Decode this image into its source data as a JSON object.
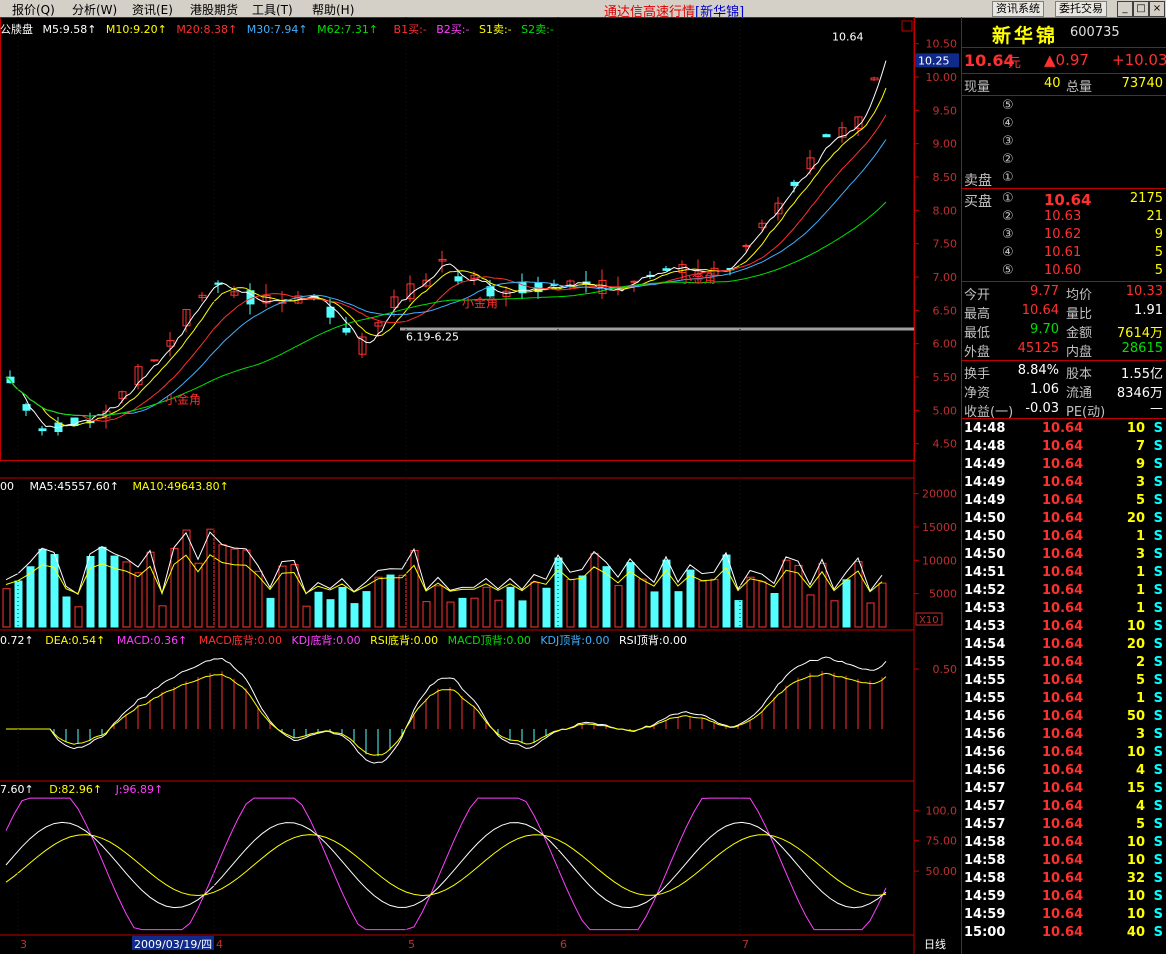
{
  "menu": {
    "items": [
      "报价(Q)",
      "分析(W)",
      "资讯(E)",
      "港股期货",
      "工具(T)",
      "帮助(H)"
    ],
    "title": "通达信高速行情",
    "title_stock": "[新华锦]",
    "btn_info": "资讯系统",
    "btn_trade": "委托交易",
    "win_min": "_",
    "win_max": "□",
    "win_close": "×"
  },
  "main_legend": {
    "title": "公牍盘",
    "ma5": "M5:9.58↑",
    "ma10": "M10:9.20↑",
    "ma20": "M20:8.38↑",
    "ma30": "M30:7.94↑",
    "ma62": "M62:7.31↑",
    "b1": "B1买:-",
    "b2": "B2买:-",
    "s1": "S1卖:-",
    "s2": "S2卖:-"
  },
  "price_axis": [
    "10.50",
    "10.00",
    "9.50",
    "9.00",
    "8.50",
    "8.00",
    "7.50",
    "7.00",
    "6.50",
    "6.00",
    "5.50",
    "5.00",
    "4.50"
  ],
  "current_price_tag": "10.25",
  "annotations": {
    "high_label": "10.64",
    "range_label": "6.19-6.25",
    "gold1": "小金角",
    "gold2": "小金角",
    "gold3": "小金角"
  },
  "vol_legend": {
    "v": "00",
    "ma5": "MA5:45557.60↑",
    "ma10": "MA10:49643.80↑"
  },
  "vol_axis": [
    "20000",
    "15000",
    "10000",
    "5000"
  ],
  "vol_unit": "X10",
  "macd_legend": {
    "dif": "0.72↑",
    "dea": "DEA:0.54↑",
    "macd": "MACD:0.36↑",
    "b1": "MACD底背:0.00",
    "b2": "KDJ底背:0.00",
    "b3": "RSI底背:0.00",
    "t1": "MACD顶背:0.00",
    "t2": "KDJ顶背:0.00",
    "t3": "RSI顶背:0.00"
  },
  "macd_axis": [
    "0.50"
  ],
  "kdj_legend": {
    "k": "7.60↑",
    "d": "D:82.96↑",
    "j": "J:96.89↑"
  },
  "kdj_axis": [
    "100.0",
    "75.00",
    "50.00"
  ],
  "date_axis": {
    "m3": "3",
    "date": "2009/03/19/四",
    "m4": "4",
    "m5": "5",
    "m6": "6",
    "m7": "7",
    "period": "日线"
  },
  "stock": {
    "name": "新华锦",
    "code": "600735",
    "price": "10.64",
    "unit": "元",
    "change": "▲0.97",
    "pct": "+10.03"
  },
  "volume_row": {
    "l1": "现量",
    "v1": "40",
    "l2": "总量",
    "v2": "73740"
  },
  "sell_label": "卖盘",
  "buy_label": "买盘",
  "sell_levels": [
    "⑤",
    "④",
    "③",
    "②",
    "①"
  ],
  "buy_levels": [
    {
      "n": "①",
      "p": "10.64",
      "v": "2175"
    },
    {
      "n": "②",
      "p": "10.63",
      "v": "21"
    },
    {
      "n": "③",
      "p": "10.62",
      "v": "9"
    },
    {
      "n": "④",
      "p": "10.61",
      "v": "5"
    },
    {
      "n": "⑤",
      "p": "10.60",
      "v": "5"
    }
  ],
  "stats": [
    {
      "l1": "今开",
      "v1": "9.77",
      "l2": "均价",
      "v2": "10.33"
    },
    {
      "l1": "最高",
      "v1": "10.64",
      "l2": "量比",
      "v2": "1.91"
    },
    {
      "l1": "最低",
      "v1": "9.70",
      "l2": "金额",
      "v2": "7614万"
    },
    {
      "l1": "外盘",
      "v1": "45125",
      "l2": "内盘",
      "v2": "28615"
    }
  ],
  "stats2": [
    {
      "l1": "换手",
      "v1": "8.84%",
      "l2": "股本",
      "v2": "1.55亿"
    },
    {
      "l1": "净资",
      "v1": "1.06",
      "l2": "流通",
      "v2": "8346万"
    },
    {
      "l1": "收益(一)",
      "v1": "-0.03",
      "l2": "PE(动)",
      "v2": "—"
    }
  ],
  "ticks": [
    {
      "t": "14:48",
      "p": "10.64",
      "v": "10",
      "s": "S"
    },
    {
      "t": "14:48",
      "p": "10.64",
      "v": "7",
      "s": "S"
    },
    {
      "t": "14:49",
      "p": "10.64",
      "v": "9",
      "s": "S"
    },
    {
      "t": "14:49",
      "p": "10.64",
      "v": "3",
      "s": "S"
    },
    {
      "t": "14:49",
      "p": "10.64",
      "v": "5",
      "s": "S"
    },
    {
      "t": "14:50",
      "p": "10.64",
      "v": "20",
      "s": "S"
    },
    {
      "t": "14:50",
      "p": "10.64",
      "v": "1",
      "s": "S"
    },
    {
      "t": "14:50",
      "p": "10.64",
      "v": "3",
      "s": "S"
    },
    {
      "t": "14:51",
      "p": "10.64",
      "v": "1",
      "s": "S"
    },
    {
      "t": "14:52",
      "p": "10.64",
      "v": "1",
      "s": "S"
    },
    {
      "t": "14:53",
      "p": "10.64",
      "v": "1",
      "s": "S"
    },
    {
      "t": "14:53",
      "p": "10.64",
      "v": "10",
      "s": "S"
    },
    {
      "t": "14:54",
      "p": "10.64",
      "v": "20",
      "s": "S"
    },
    {
      "t": "14:55",
      "p": "10.64",
      "v": "2",
      "s": "S"
    },
    {
      "t": "14:55",
      "p": "10.64",
      "v": "5",
      "s": "S"
    },
    {
      "t": "14:55",
      "p": "10.64",
      "v": "1",
      "s": "S"
    },
    {
      "t": "14:56",
      "p": "10.64",
      "v": "50",
      "s": "S"
    },
    {
      "t": "14:56",
      "p": "10.64",
      "v": "3",
      "s": "S"
    },
    {
      "t": "14:56",
      "p": "10.64",
      "v": "10",
      "s": "S"
    },
    {
      "t": "14:56",
      "p": "10.64",
      "v": "4",
      "s": "S"
    },
    {
      "t": "14:57",
      "p": "10.64",
      "v": "15",
      "s": "S"
    },
    {
      "t": "14:57",
      "p": "10.64",
      "v": "4",
      "s": "S"
    },
    {
      "t": "14:57",
      "p": "10.64",
      "v": "5",
      "s": "S"
    },
    {
      "t": "14:58",
      "p": "10.64",
      "v": "10",
      "s": "S"
    },
    {
      "t": "14:58",
      "p": "10.64",
      "v": "10",
      "s": "S"
    },
    {
      "t": "14:58",
      "p": "10.64",
      "v": "32",
      "s": "S"
    },
    {
      "t": "14:59",
      "p": "10.64",
      "v": "10",
      "s": "S"
    },
    {
      "t": "14:59",
      "p": "10.64",
      "v": "10",
      "s": "S"
    },
    {
      "t": "15:00",
      "p": "10.64",
      "v": "40",
      "s": "S"
    }
  ],
  "colors": {
    "up": "#ff3232",
    "down": "#54ffff",
    "ma5": "#ffffff",
    "ma10": "#ffff00",
    "ma20": "#ff3030",
    "ma30": "#40b0ff",
    "ma62": "#00e000",
    "frame": "#c00000"
  }
}
